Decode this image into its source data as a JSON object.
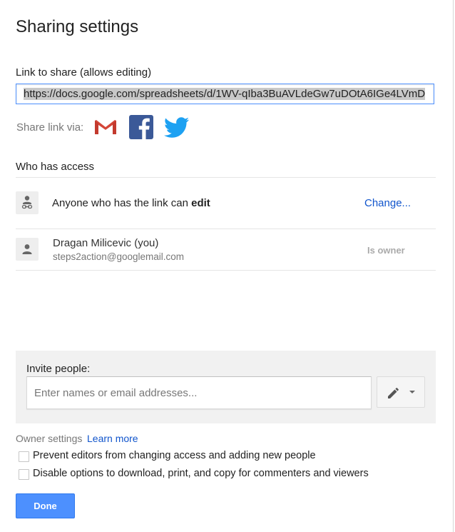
{
  "dialog": {
    "title": "Sharing settings"
  },
  "link": {
    "label": "Link to share (allows editing)",
    "url": "https://docs.google.com/spreadsheets/d/1WV-qIba3BuAVLdeGw7uDOtA6IGe4LVmD"
  },
  "share_via": {
    "label": "Share link via:",
    "services": [
      "gmail-icon",
      "facebook-icon",
      "twitter-icon"
    ],
    "colors": {
      "gmail_red": "#d44638",
      "facebook_blue": "#3b5998",
      "twitter_blue": "#1da1f2"
    }
  },
  "access": {
    "heading": "Who has access",
    "link_access": {
      "text_prefix": "Anyone who has the link can ",
      "permission": "edit",
      "change_label": "Change..."
    },
    "owner": {
      "name": "Dragan Milicevic (you)",
      "email": "steps2action@googlemail.com",
      "role": "Is owner"
    }
  },
  "invite": {
    "label": "Invite people:",
    "placeholder": "Enter names or email addresses...",
    "permission_icon": "pencil-icon"
  },
  "owner_settings": {
    "label": "Owner settings",
    "learn_more": "Learn more",
    "options": [
      {
        "label": "Prevent editors from changing access and adding new people",
        "checked": false
      },
      {
        "label": "Disable options to download, print, and copy for commenters and viewers",
        "checked": false
      }
    ]
  },
  "footer": {
    "done_label": "Done",
    "accent": "#4d90fe"
  }
}
